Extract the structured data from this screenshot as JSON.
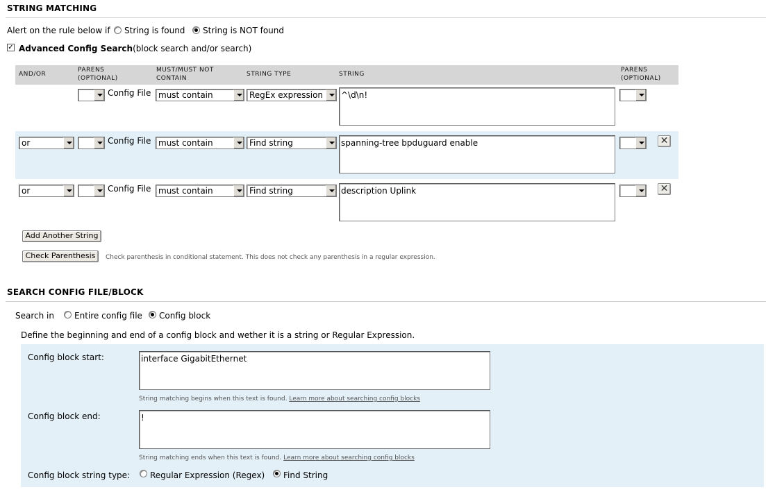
{
  "string_matching": {
    "title": "STRING MATCHING",
    "alert_label": "Alert on the rule below if",
    "radio_found": "String is found",
    "radio_not_found": "String is NOT found",
    "selected": "not_found",
    "advanced_checked": true,
    "advanced_label_bold": "Advanced Config Search",
    "advanced_label_rest": "(block search and/or search)"
  },
  "table": {
    "headers": {
      "andor": "AND/OR",
      "parens_open_1": "PARENS",
      "parens_open_2": "(OPTIONAL)",
      "must_1": "MUST/MUST NOT",
      "must_2": "CONTAIN",
      "string_type": "STRING TYPE",
      "string": "STRING",
      "parens_close_1": "PARENS",
      "parens_close_2": "(OPTIONAL)"
    },
    "rows": [
      {
        "andor": "",
        "open_paren": "",
        "source": "Config File",
        "must": "must contain",
        "type": "RegEx expression",
        "string": "^\\d\\n!",
        "close_paren": "",
        "removable": false
      },
      {
        "andor": "or",
        "open_paren": "",
        "source": "Config File",
        "must": "must contain",
        "type": "Find string",
        "string": "spanning-tree bpduguard enable",
        "close_paren": "",
        "removable": true
      },
      {
        "andor": "or",
        "open_paren": "",
        "source": "Config File",
        "must": "must contain",
        "type": "Find string",
        "string": "description Uplink",
        "close_paren": "",
        "removable": true
      }
    ],
    "remove_symbol": "✕"
  },
  "buttons": {
    "add_another": "Add Another String",
    "check_parens": "Check Parenthesis",
    "check_parens_help": "Check parenthesis in conditional statement. This does not check any parenthesis in a regular expression."
  },
  "search_block": {
    "title": "SEARCH CONFIG FILE/BLOCK",
    "search_in_label": "Search in",
    "radio_entire": "Entire config file",
    "radio_block": "Config block",
    "selected": "block",
    "define_text": "Define the beginning and end of a config block and wether it is a string or Regular Expression.",
    "start_label": "Config block start:",
    "start_value": "interface GigabitEthernet",
    "start_help": "String matching begins when this text is found.",
    "start_link": "Learn more about searching config blocks",
    "end_label": "Config block end:",
    "end_value": "!",
    "end_help": "String matching ends when this text is found.",
    "end_link": "Learn more about searching config blocks",
    "type_label": "Config block string type:",
    "type_regex": "Regular Expression (Regex)",
    "type_find": "Find String",
    "type_selected": "find"
  }
}
